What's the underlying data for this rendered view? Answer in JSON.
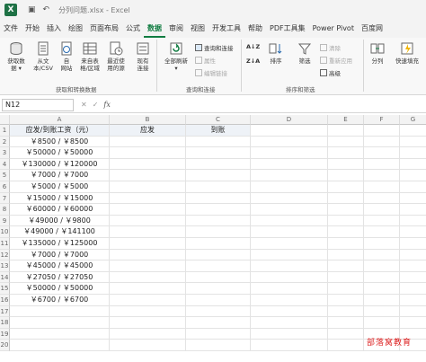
{
  "titlebar": {
    "app_icon": "excel-logo",
    "doc_title": "分列问题.xlsx  -  Excel"
  },
  "menu": {
    "tabs": [
      "文件",
      "开始",
      "插入",
      "绘图",
      "页面布局",
      "公式",
      "数据",
      "审阅",
      "视图",
      "开发工具",
      "帮助",
      "PDF工具集",
      "Power Pivot",
      "百度网"
    ],
    "active": "数据"
  },
  "ribbon": {
    "get_data": "获取数\n据 ▾",
    "from_csv": "从文\n本/CSV",
    "from_web": "自\n网站",
    "from_table": "来自表\n格/区域",
    "recent_sources": "最近使\n用的源",
    "existing_conn": "现有\n连接",
    "group1": "获取和转换数据",
    "refresh_all": "全部刷新\n▾",
    "queries_conn": "查询和连接",
    "properties": "属性",
    "edit_links": "编辑链接",
    "group2": "查询和连接",
    "sort_az": "A↓Z",
    "sort_za": "Z↓A",
    "sort": "排序",
    "filter": "筛选",
    "clear": "清除",
    "reapply": "重新应用",
    "advanced": "高级",
    "group3": "排序和筛选",
    "text_to_columns": "分列",
    "flash_fill": "快速填充"
  },
  "formula": {
    "name_box": "N12",
    "cancel": "✕",
    "enter": "✓",
    "fx": "fx",
    "content": ""
  },
  "columns": [
    "A",
    "B",
    "C",
    "D",
    "E",
    "F",
    "G"
  ],
  "rows": [
    "1",
    "2",
    "3",
    "4",
    "5",
    "6",
    "7",
    "8",
    "9",
    "10",
    "11",
    "12",
    "13",
    "14",
    "15",
    "16",
    "17",
    "18",
    "19",
    "20"
  ],
  "header": {
    "a1": "应发/到账工资（元）",
    "b1": "应发",
    "c1": "到账"
  },
  "data_a": [
    "￥8500 / ￥8500",
    "￥50000 / ￥50000",
    "￥130000 / ￥120000",
    "￥7000 / ￥7000",
    "￥5000 / ￥5000",
    "￥15000 / ￥15000",
    "￥60000 / ￥60000",
    "￥49000 / ￥9800",
    "￥49000 / ￥141100",
    "￥135000 / ￥125000",
    "￥7000 / ￥7000",
    "￥45000 / ￥45000",
    "￥27050 / ￥27050",
    "￥50000 / ￥50000",
    "￥6700 / ￥6700"
  ],
  "watermark": "部落窝教育",
  "colors": {
    "accent": "#107c41",
    "header_fill": "#eef2f7",
    "watermark": "#dd2222"
  }
}
